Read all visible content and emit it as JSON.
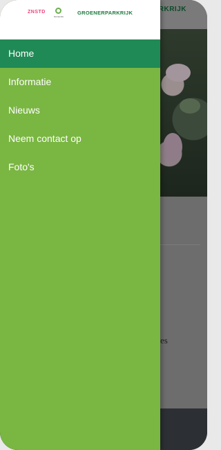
{
  "header": {
    "title_fragment": "RKRIJK"
  },
  "logos": {
    "znstd": "ZNSTD",
    "gemeente": "Gemeente",
    "groenerparkrijk": "GROENERPARKRIJK"
  },
  "menu": {
    "items": [
      {
        "label": "Home",
        "active": true
      },
      {
        "label": "Informatie",
        "active": false
      },
      {
        "label": "Nieuws",
        "active": false
      },
      {
        "label": "Neem contact op",
        "active": false
      },
      {
        "label": "Foto's",
        "active": false
      }
    ]
  },
  "background": {
    "text_fragment": "es"
  },
  "colors": {
    "drawer": "#7ab642",
    "active_item": "#1f8a55",
    "brand_green": "#1b7a3e"
  }
}
